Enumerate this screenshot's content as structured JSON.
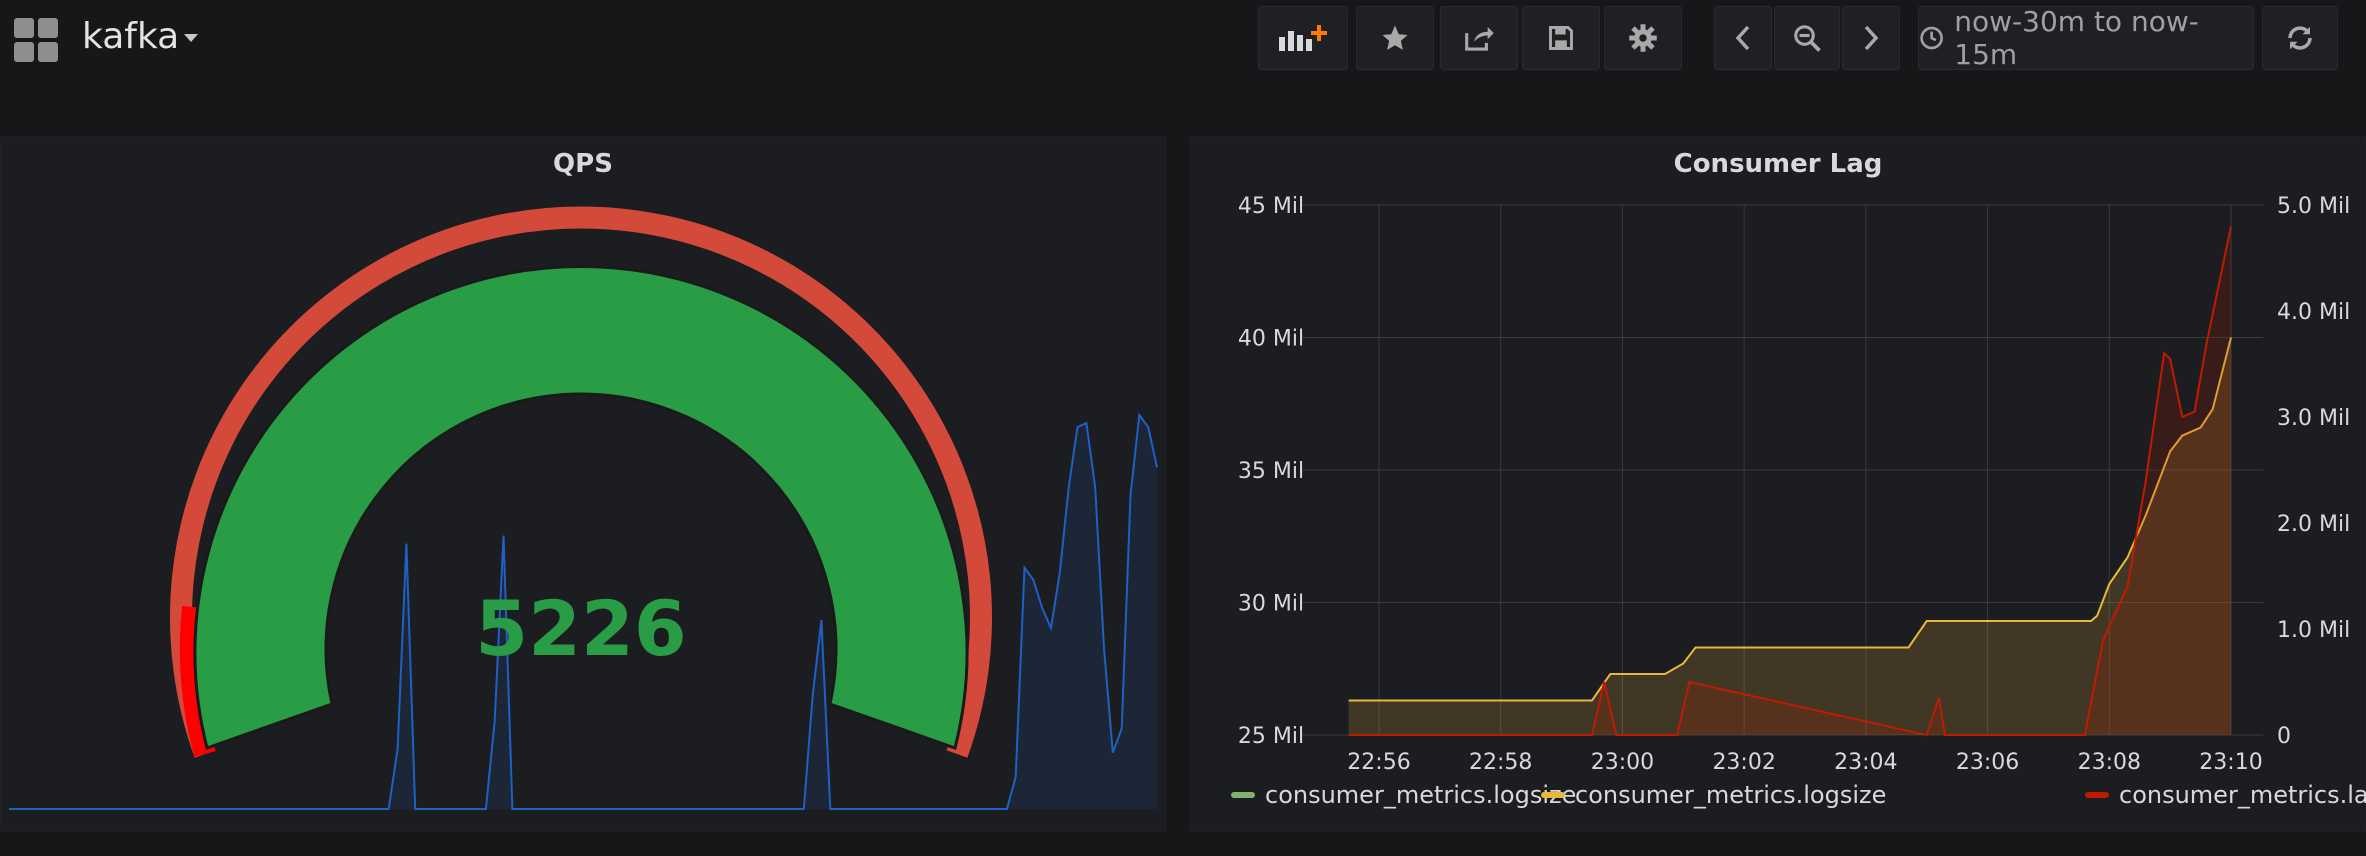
{
  "dashboard": {
    "title": "kafka"
  },
  "toolbar": {
    "add_panel_icon": "add-panel-icon",
    "star_icon": "star-icon",
    "share_icon": "share-icon",
    "save_icon": "save-icon",
    "settings_icon": "gear-icon",
    "time_back_icon": "chevron-left-icon",
    "zoom_out_icon": "zoom-out-icon",
    "time_forward_icon": "chevron-right-icon",
    "time_range": "now-30m to now-15m",
    "refresh_icon": "refresh-icon"
  },
  "panels": [
    {
      "title": "QPS",
      "type": "singlestat-gauge",
      "value": "5226",
      "value_color": "#299c46",
      "gauge_fill_color": "#299c46",
      "threshold_color": "#d44a3a",
      "sparkline_color": "#1f60c4",
      "sparkline": [
        0,
        0,
        0,
        0,
        0,
        0,
        0,
        0,
        0,
        0,
        0,
        0,
        0,
        0,
        0,
        0,
        0,
        0,
        0,
        0,
        0,
        0,
        0,
        0,
        0,
        0,
        0,
        0,
        0,
        0,
        0,
        0,
        0,
        0,
        0,
        0,
        0,
        0,
        0,
        0,
        0,
        0,
        0,
        0,
        0.15,
        0.66,
        0,
        0,
        0,
        0,
        0,
        0,
        0,
        0,
        0,
        0.22,
        0.68,
        0,
        0,
        0,
        0,
        0,
        0,
        0,
        0,
        0,
        0,
        0,
        0,
        0,
        0,
        0,
        0,
        0,
        0,
        0,
        0,
        0,
        0,
        0,
        0,
        0,
        0,
        0,
        0,
        0,
        0,
        0,
        0,
        0,
        0,
        0.28,
        0.47,
        0,
        0,
        0,
        0,
        0,
        0,
        0,
        0,
        0,
        0,
        0,
        0,
        0,
        0,
        0,
        0,
        0,
        0,
        0,
        0,
        0,
        0.08,
        0.6,
        0.57,
        0.5,
        0.45,
        0.59,
        0.8,
        0.95,
        0.96,
        0.8,
        0.4,
        0.14,
        0.2,
        0.78,
        0.98,
        0.95,
        0.85
      ]
    },
    {
      "title": "Consumer Lag",
      "type": "graph",
      "legend": [
        {
          "label": "consumer_metrics.logsize",
          "color": "#7eb26d"
        },
        {
          "label": "consumer_metrics.logsize",
          "color": "#eab839"
        },
        {
          "label": "consumer_metrics.lag",
          "color": "#bf1b00"
        }
      ]
    }
  ],
  "chart_data": {
    "type": "line",
    "title": "Consumer Lag",
    "x_ticks": [
      "22:56",
      "22:58",
      "23:00",
      "23:02",
      "23:04",
      "23:06",
      "23:08",
      "23:10"
    ],
    "y_left_ticks": [
      "25 Mil",
      "30 Mil",
      "35 Mil",
      "40 Mil",
      "45 Mil"
    ],
    "y_left_range": [
      25000000,
      45000000
    ],
    "y_right_ticks": [
      "0",
      "1.0 Mil",
      "2.0 Mil",
      "3.0 Mil",
      "4.0 Mil",
      "5.0 Mil"
    ],
    "y_right_range": [
      0,
      5000000
    ],
    "grid": true,
    "legend_position": "bottom",
    "series": [
      {
        "name": "consumer_metrics.logsize",
        "color": "#eab839",
        "axis": "left",
        "fill": true,
        "x": [
          "22:55.5",
          "22:59.5",
          "22:59.8",
          "23:00.7",
          "23:01.0",
          "23:01.2",
          "23:04.7",
          "23:05.0",
          "23:07.7",
          "23:07.8",
          "23:08.0",
          "23:08.3",
          "23:08.6",
          "23:09.0",
          "23:09.2",
          "23:09.5",
          "23:09.7",
          "23:10.0"
        ],
        "values": [
          26.3,
          26.3,
          27.3,
          27.3,
          27.7,
          28.3,
          28.3,
          29.3,
          29.3,
          29.5,
          30.7,
          31.7,
          33.3,
          35.7,
          36.3,
          36.6,
          37.3,
          40.0
        ]
      },
      {
        "name": "consumer_metrics.lag",
        "color": "#bf1b00",
        "axis": "right",
        "fill": true,
        "x": [
          "22:55.5",
          "22:59.5",
          "22:59.7",
          "22:59.9",
          "23:00.5",
          "23:00.9",
          "23:01.1",
          "23:05.0",
          "23:05.2",
          "23:05.3",
          "23:07.6",
          "23:07.9",
          "23:08.3",
          "23:08.6",
          "23:08.9",
          "23:09.0",
          "23:09.2",
          "23:09.4",
          "23:09.6",
          "23:10.0"
        ],
        "values": [
          0,
          0,
          0.5,
          0,
          0,
          0,
          0.5,
          0,
          0.35,
          0,
          0,
          0.9,
          1.4,
          2.4,
          3.6,
          3.55,
          3.0,
          3.05,
          3.7,
          4.8
        ]
      }
    ]
  }
}
